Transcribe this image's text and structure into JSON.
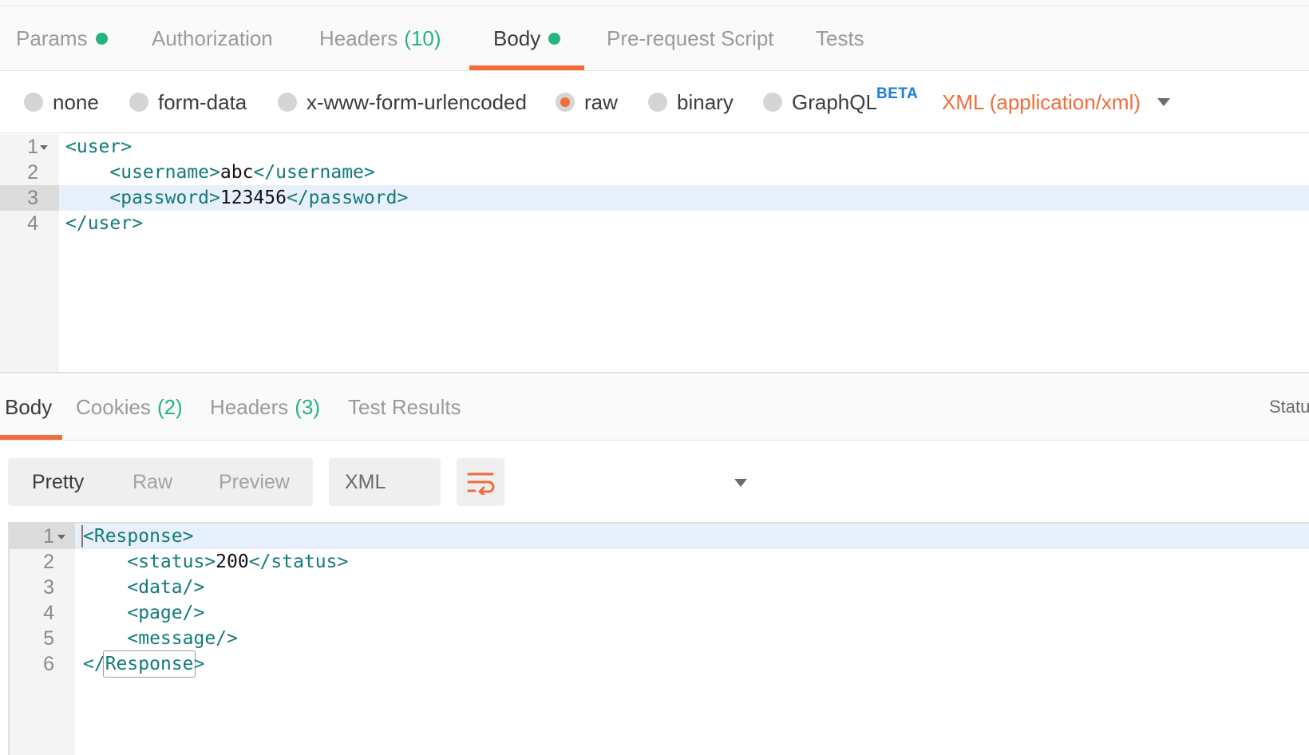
{
  "request_tabs": {
    "params": {
      "label": "Params"
    },
    "authorization": {
      "label": "Authorization"
    },
    "headers": {
      "label": "Headers",
      "count": "(10)"
    },
    "body": {
      "label": "Body"
    },
    "pre_request": {
      "label": "Pre-request Script"
    },
    "tests": {
      "label": "Tests"
    }
  },
  "body_types": {
    "options": [
      "none",
      "form-data",
      "x-www-form-urlencoded",
      "raw",
      "binary",
      "GraphQL"
    ],
    "selected": "raw",
    "graphql_badge": "BETA",
    "language": "XML (application/xml)"
  },
  "request_editor": {
    "line_numbers": [
      "1",
      "2",
      "3",
      "4"
    ],
    "lines": [
      {
        "indent": "",
        "open": "<user>",
        "text": "",
        "close": ""
      },
      {
        "indent": "    ",
        "open": "<username>",
        "text": "abc",
        "close": "</username>"
      },
      {
        "indent": "    ",
        "open": "<password>",
        "text": "123456",
        "close": "</password>"
      },
      {
        "indent": "",
        "open": "</user>",
        "text": "",
        "close": ""
      }
    ]
  },
  "response_tabs": {
    "body": {
      "label": "Body"
    },
    "cookies": {
      "label": "Cookies",
      "count": "(2)"
    },
    "headers": {
      "label": "Headers",
      "count": "(3)"
    },
    "test_results": {
      "label": "Test Results"
    },
    "status_partial": "Statu"
  },
  "response_toolbar": {
    "views": [
      "Pretty",
      "Raw",
      "Preview"
    ],
    "active_view": "Pretty",
    "format": "XML"
  },
  "response_editor": {
    "line_numbers": [
      "1",
      "2",
      "3",
      "4",
      "5",
      "6"
    ],
    "lines": [
      {
        "indent": "",
        "open": "<Response>",
        "text": "",
        "close": ""
      },
      {
        "indent": "    ",
        "open": "<status>",
        "text": "200",
        "close": "</status>"
      },
      {
        "indent": "    ",
        "open": "<data/>",
        "text": "",
        "close": ""
      },
      {
        "indent": "    ",
        "open": "<page/>",
        "text": "",
        "close": ""
      },
      {
        "indent": "    ",
        "open": "<message/>",
        "text": "",
        "close": ""
      },
      {
        "indent": "",
        "open": "</",
        "text": "",
        "close": "",
        "boxed": "Response",
        "tail": ">"
      }
    ]
  },
  "colors": {
    "accent": "#f26b3a",
    "dot_green": "#26b47f",
    "tag_teal": "#137a7a",
    "beta_blue": "#1d7cd8"
  },
  "icons": {
    "wrap": "wrap-lines-icon",
    "dropdown": "chevron-down-icon",
    "fold": "fold-caret-icon"
  }
}
